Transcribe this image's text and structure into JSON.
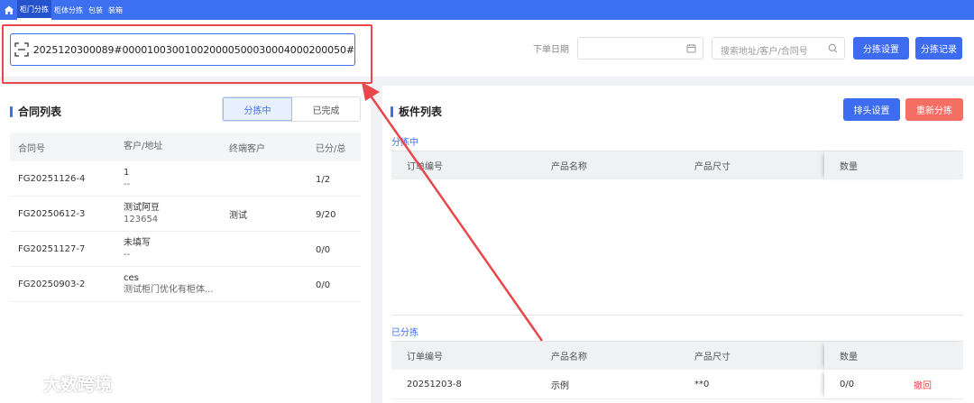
{
  "nav": {
    "tabs": [
      {
        "label": "柜门分拣",
        "active": true
      },
      {
        "label": "柜体分拣",
        "active": false
      },
      {
        "label": "包装",
        "active": false
      },
      {
        "label": "装箱",
        "active": false
      }
    ]
  },
  "scan": {
    "value": "2025120300089#000010030010020000500030004000200050#"
  },
  "filters": {
    "date_label": "下单日期",
    "date_value": "",
    "search_placeholder": "搜索地址/客户/合同号",
    "sort_settings_label": "分拣设置",
    "sort_records_label": "分拣记录"
  },
  "contracts": {
    "title": "合同列表",
    "seg_active": "分拣中",
    "seg_inactive": "已完成",
    "columns": [
      "合同号",
      "客户/地址",
      "终端客户",
      "已分/总"
    ],
    "rows": [
      {
        "contract": "FG20251126-4",
        "customer": "1",
        "address": "--",
        "end_customer": "",
        "done": "1",
        "total": "/2"
      },
      {
        "contract": "FG20250612-3",
        "customer": "测试阿豆",
        "address": "123654",
        "end_customer": "测试",
        "done": "9",
        "total": "/20"
      },
      {
        "contract": "FG20251127-7",
        "customer": "未填写",
        "address": "--",
        "end_customer": "",
        "done": "0",
        "total": "/0"
      },
      {
        "contract": "FG20250903-2",
        "customer": "ces",
        "address": "测试柜门优化有柜体...",
        "end_customer": "",
        "done": "0",
        "total": "/0"
      }
    ]
  },
  "boards": {
    "title": "板件列表",
    "header_settings_label": "排头设置",
    "resort_label": "重新分拣",
    "sorting_label": "分拣中",
    "sorted_label": "已分拣",
    "columns": [
      "订单编号",
      "产品名称",
      "产品尺寸",
      "数量"
    ],
    "sorted_rows": [
      {
        "order": "20251203-8",
        "product": "示例",
        "size": "**0",
        "qty": "0/0",
        "action": "撤回"
      }
    ]
  },
  "watermark": {
    "text": "大数跨境"
  },
  "colors": {
    "primary": "#3c70f0",
    "danger": "#f46e63",
    "annotation": "#e8474b",
    "success": "#27b38b"
  }
}
